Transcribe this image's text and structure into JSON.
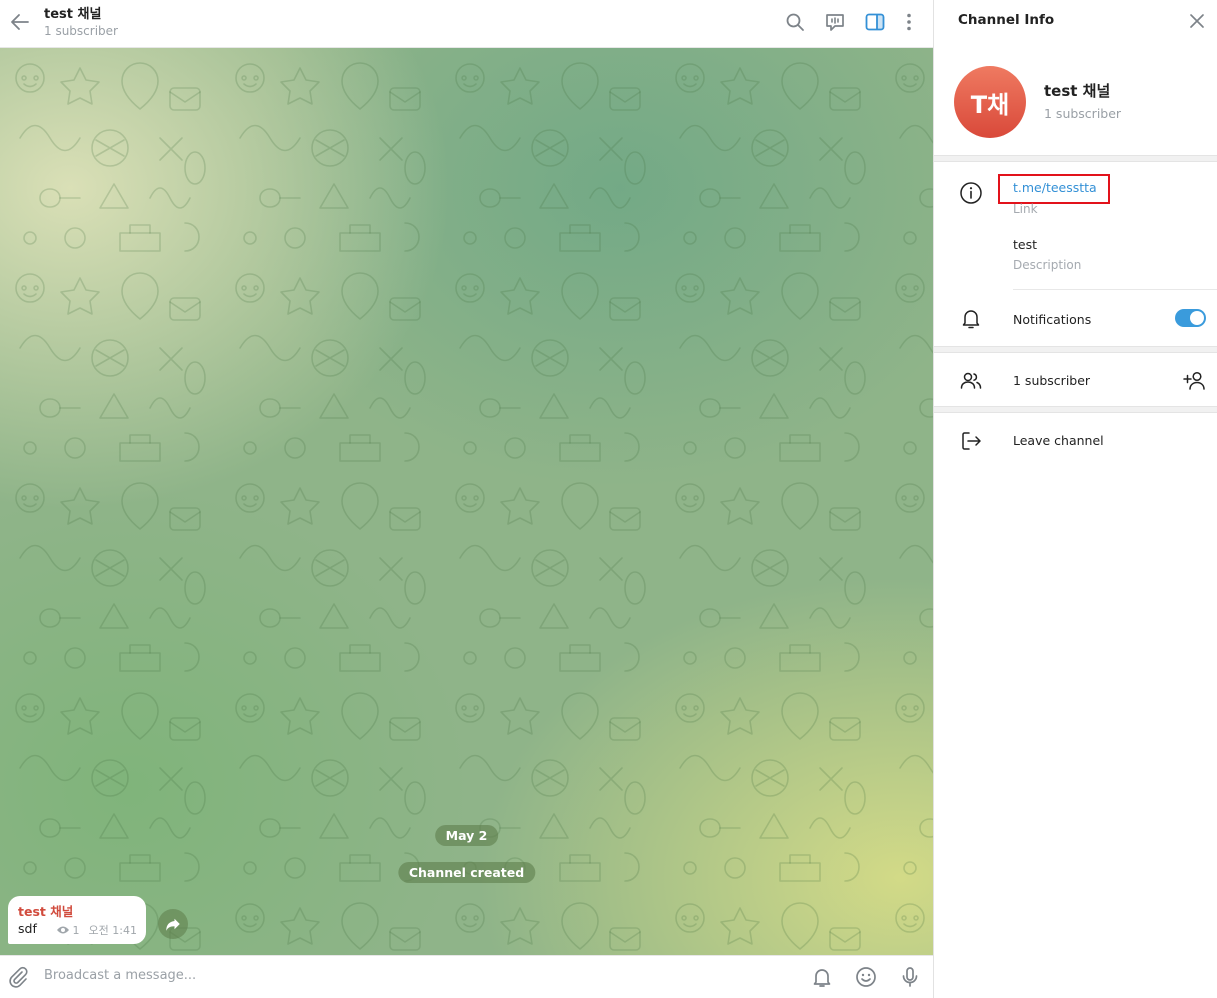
{
  "header": {
    "title": "test 채널",
    "subtitle": "1 subscriber"
  },
  "chat": {
    "date_label": "May 2",
    "service_label": "Channel created",
    "message": {
      "author": "test 채널",
      "text": "sdf",
      "views": "1",
      "time": "오전 1:41"
    }
  },
  "composer": {
    "placeholder": "Broadcast a message..."
  },
  "info_panel": {
    "title": "Channel Info",
    "avatar_initials": "T채",
    "channel_name": "test 채널",
    "channel_subtitle": "1 subscriber",
    "link_value": "t.me/teesstta",
    "link_caption": "Link",
    "description_value": "test",
    "description_caption": "Description",
    "notifications_label": "Notifications",
    "notifications_on": true,
    "subscribers_label": "1 subscriber",
    "leave_label": "Leave channel"
  },
  "colors": {
    "accent": "#3390d6",
    "author": "#d14b3d",
    "highlight_box": "#e2121b",
    "avatar": "#e05a45"
  }
}
